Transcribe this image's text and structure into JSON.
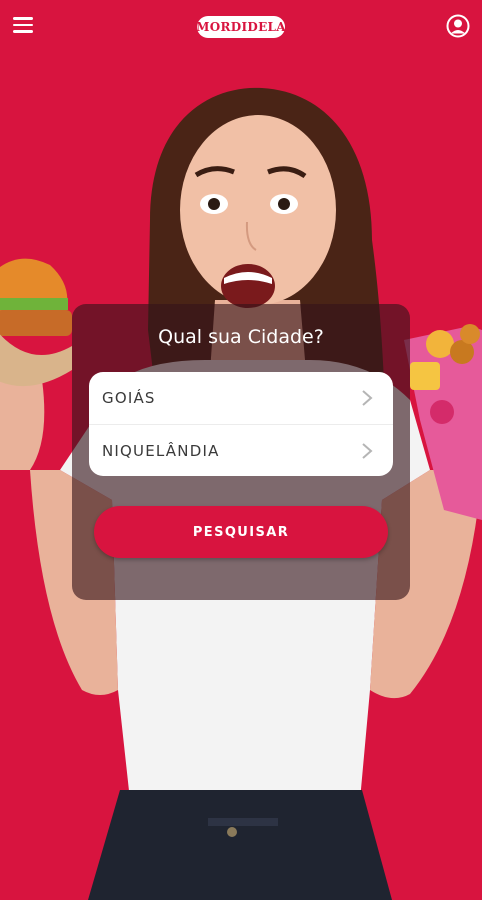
{
  "header": {
    "brand": "MORDIDELA",
    "menu_icon": "hamburger-menu-icon",
    "profile_icon": "user-profile-icon"
  },
  "city_form": {
    "title": "Qual sua Cidade?",
    "state_value": "GOIÁS",
    "city_value": "NIQUELÂNDIA",
    "search_label": "PESQUISAR"
  },
  "colors": {
    "brand_red": "#d8143f",
    "panel_overlay": "rgba(54,20,26,0.62)",
    "white": "#ffffff"
  }
}
